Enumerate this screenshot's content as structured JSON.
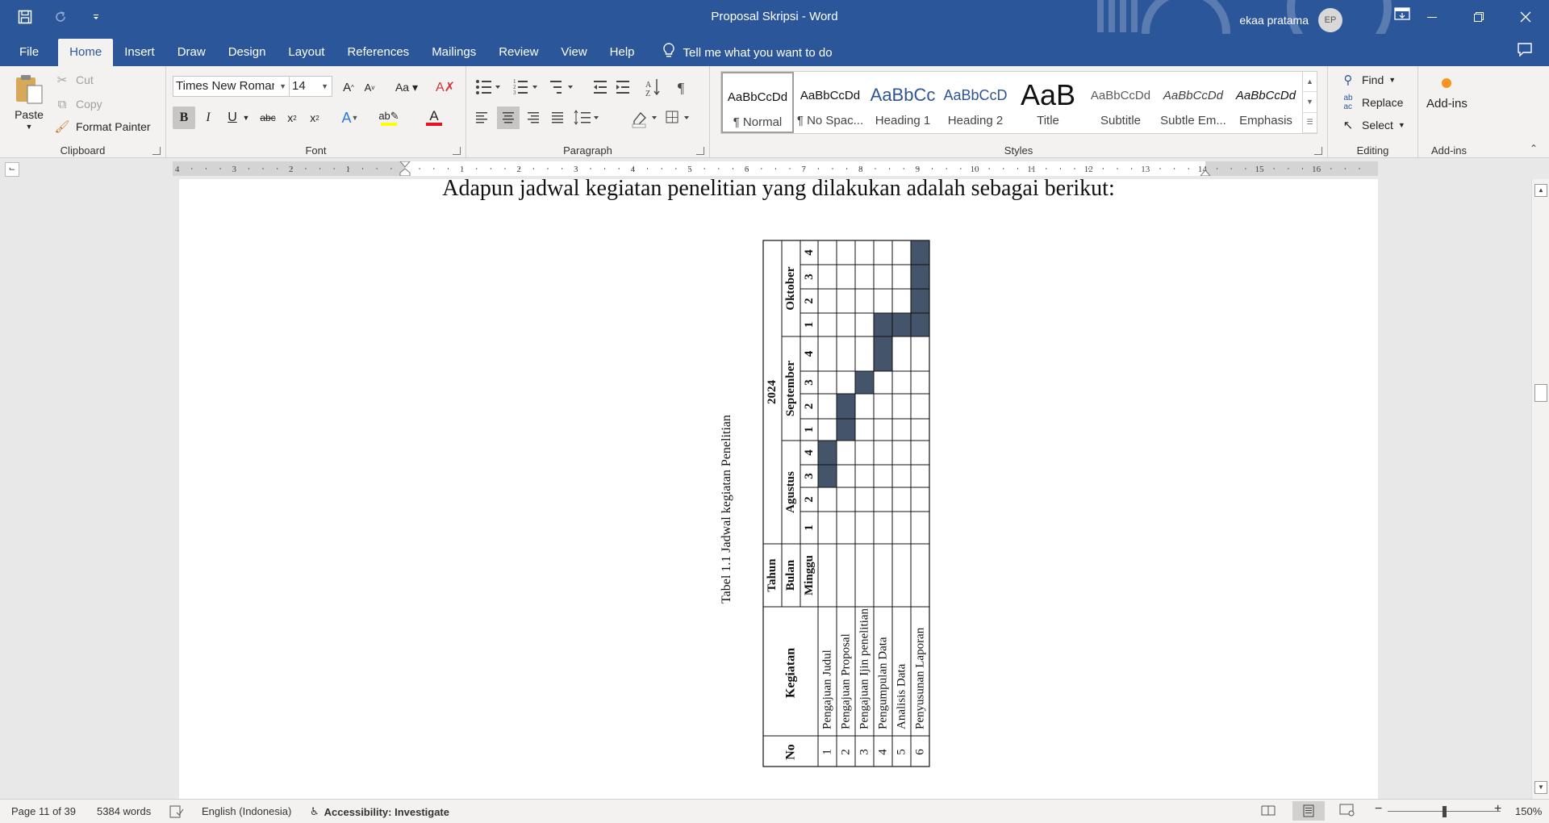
{
  "window": {
    "title": "Proposal Skripsi  -  Word",
    "user_name": "ekaa pratama",
    "user_initials": "EP"
  },
  "tabs": [
    "File",
    "Home",
    "Insert",
    "Draw",
    "Design",
    "Layout",
    "References",
    "Mailings",
    "Review",
    "View",
    "Help"
  ],
  "active_tab": "Home",
  "tell_me": "Tell me what you want to do",
  "clipboard": {
    "paste": "Paste",
    "cut": "Cut",
    "copy": "Copy",
    "format_painter": "Format Painter",
    "label": "Clipboard"
  },
  "font": {
    "name": "Times New Roman",
    "size": "14",
    "label": "Font"
  },
  "paragraph": {
    "label": "Paragraph"
  },
  "styles": {
    "label": "Styles",
    "items": [
      {
        "preview": "AaBbCcDd",
        "name": "¶ Normal"
      },
      {
        "preview": "AaBbCcDd",
        "name": "¶ No Spac..."
      },
      {
        "preview": "AaBbCc",
        "name": "Heading 1"
      },
      {
        "preview": "AaBbCcD",
        "name": "Heading 2"
      },
      {
        "preview": "AaB",
        "name": "Title"
      },
      {
        "preview": "AaBbCcDd",
        "name": "Subtitle"
      },
      {
        "preview": "AaBbCcDd",
        "name": "Subtle Em..."
      },
      {
        "preview": "AaBbCcDd",
        "name": "Emphasis"
      }
    ]
  },
  "editing": {
    "find": "Find",
    "replace": "Replace",
    "select": "Select",
    "label": "Editing"
  },
  "addins": {
    "button": "Add-ins",
    "label": "Add-ins"
  },
  "ruler": {
    "left_numbers": [
      "4",
      "3",
      "2",
      "1"
    ],
    "right_numbers": [
      "1",
      "2",
      "3",
      "4",
      "5",
      "6",
      "7",
      "8",
      "9",
      "10",
      "11",
      "12",
      "13",
      "14",
      "15",
      "16"
    ]
  },
  "document": {
    "heading": "Adapun jadwal kegiatan penelitian yang dilakukan adalah sebagai berikut:",
    "caption": "Tabel 1.1 Jadwal kegiatan Penelitian",
    "table": {
      "col_no": "No",
      "col_kegiatan": "Kegiatan",
      "label_tahun": "Tahun",
      "label_bulan": "Bulan",
      "label_minggu": "Minggu",
      "year": "2024",
      "months": [
        "Agustus",
        "September",
        "Oktober"
      ],
      "weeks": [
        "1",
        "2",
        "3",
        "4",
        "1",
        "2",
        "3",
        "4",
        "1",
        "2",
        "3",
        "4"
      ],
      "activities": [
        {
          "no": "1",
          "name": "Pengajuan Judul",
          "weeks_filled": [
            3,
            4
          ]
        },
        {
          "no": "2",
          "name": "Pengajuan Proposal",
          "weeks_filled": [
            5,
            6
          ]
        },
        {
          "no": "3",
          "name": "Pengajuan Ijin penelitian",
          "weeks_filled": [
            7
          ]
        },
        {
          "no": "4",
          "name": "Pengumpulan Data",
          "weeks_filled": [
            8,
            9
          ]
        },
        {
          "no": "5",
          "name": "Analisis Data",
          "weeks_filled": [
            9
          ]
        },
        {
          "no": "6",
          "name": "Penyusunan Laporan",
          "weeks_filled": [
            9,
            10,
            11,
            12
          ]
        }
      ],
      "fill_color": "#44546a"
    }
  },
  "status": {
    "page": "Page 11 of 39",
    "words": "5384 words",
    "language": "English (Indonesia)",
    "accessibility": "Accessibility: Investigate",
    "zoom": "150%"
  },
  "colors": {
    "brand": "#2b579a",
    "font_color_underline": "#e81123",
    "highlight_underline": "#ffff00"
  }
}
